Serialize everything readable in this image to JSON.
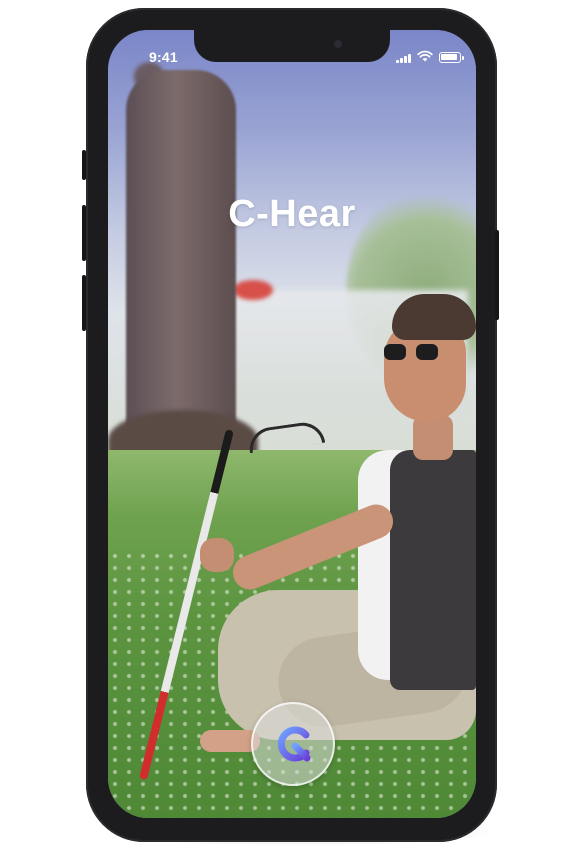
{
  "status_bar": {
    "time": "9:41",
    "signal_icon": "cellular-signal-icon",
    "wifi_icon": "wifi-icon",
    "battery_icon": "battery-icon"
  },
  "app": {
    "title": "C-Hear"
  },
  "action_button": {
    "icon": "c-hear-logo-icon",
    "colors": {
      "gradient_start": "#6fa3ff",
      "gradient_end": "#6a3fd8"
    }
  },
  "colors": {
    "phone_frame": "#1c1c1e",
    "title_text": "#ffffff"
  }
}
